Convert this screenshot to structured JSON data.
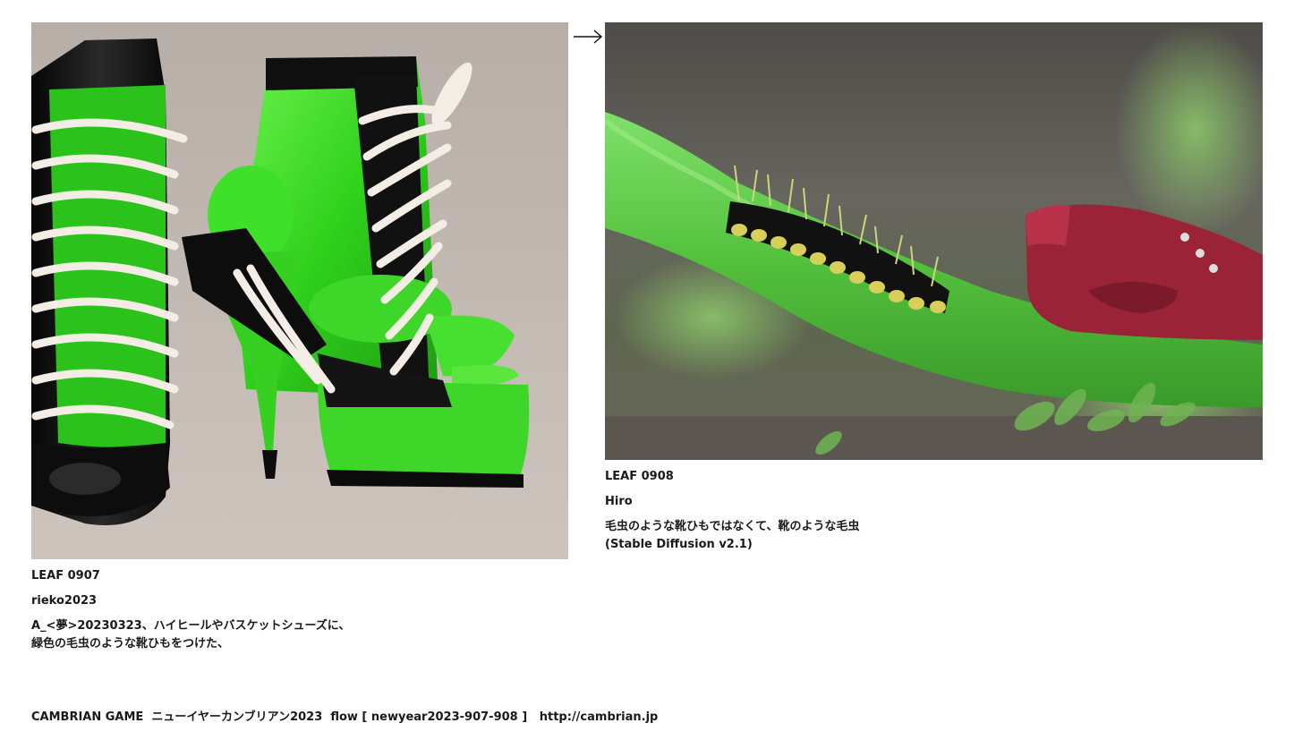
{
  "left_leaf": {
    "title": "LEAF 0907",
    "author": "rieko2023",
    "description_line1": "A_<夢>20230323、ハイヒールやバスケットシューズに、",
    "description_line2": "緑色の毛虫のような靴ひもをつけた、"
  },
  "right_leaf": {
    "title": "LEAF 0908",
    "author": "Hiro",
    "description_line1": "毛虫のような靴ひもではなくて、靴のような毛虫",
    "description_line2": "(Stable Diffusion v2.1)"
  },
  "arrow_icon": "right-arrow-icon",
  "footer": {
    "site_name": "CAMBRIAN GAME",
    "event": "ニューイヤーカンブリアン2023",
    "flow": "flow [ newyear2023-907-908 ]",
    "url": "http://cambrian.jp"
  },
  "colors": {
    "text": "#1a1a1a",
    "background": "#ffffff",
    "shoe_green": "#3fd62a",
    "shoe_red": "#9a2338"
  }
}
